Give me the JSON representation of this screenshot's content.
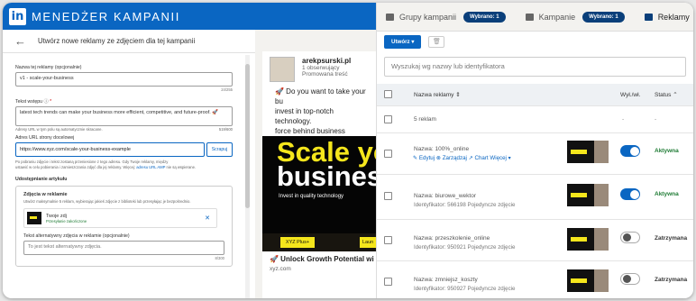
{
  "app": {
    "logo": "in",
    "title": "MENEDŻER KAMPANII"
  },
  "editor": {
    "title": "Utwórz nowe reklamy ze zdjęciem dla tej kampanii",
    "ad_name_label": "Nazwa tej reklamy (opcjonalnie)",
    "ad_name_value": "v1 - scale-your-business",
    "ad_name_count": "24/255",
    "intro_label": "Tekst wstępu",
    "intro_value": "latest tech trends can make your business more efficient, competitive, and future-proof. 🚀",
    "intro_hint": "Adresy URL w tym polu są automatycznie skracane.",
    "intro_count": "519/600",
    "url_label": "Adres URL strony docelowej",
    "url_value": "https://www.xyz.com/scale-your-business-example",
    "scrape_label": "Scrapuj",
    "url_hint_1": "Po pobraniu zdjęcie i tekst zostaną przeniesione z tego adresu. Gdy Twoje reklamy, między",
    "url_hint_2": "ustawić w celu pobierania i zamieszczania zdjęć dla jej reklamy. Więcej: ",
    "url_hint_link": "adresu URL AMP",
    "url_hint_3": " nie są wspierane.",
    "article_label": "Udostępnianie artykułu",
    "image_label": "Zdjęcia w reklamie",
    "image_hint": "Utwórz maksymalnie 5 reklam, wybierając jakieś zdjęcie z biblioteki lub przesyłając je bezpośrednio.",
    "photo_name": "Twoje zdj",
    "photo_sub": "Przesyłanie zakończone",
    "alt_label": "Tekst alternatywny zdjęcia w reklamie (opcjonalnie)",
    "alt_placeholder": "To jest tekst alternatywny zdjęcia.",
    "alt_count": "8/300"
  },
  "preview": {
    "name": "arekpsurski.pl",
    "followers": "1 obserwujący",
    "promoted": "Promowana treść",
    "body_1": "🚀 Do you want to take your bu",
    "body_2": "invest in top-notch technology.",
    "body_3": "force behind business growth. #",
    "img_big_1": "Scale yo",
    "img_big_2": "busines",
    "img_tag": "Invest in quality technology",
    "img_btn": "XYZ Plus+",
    "img_btn2": "Laun",
    "cta": "🚀 Unlock Growth Potential wi",
    "domain": "xyz.com"
  },
  "tabs": [
    {
      "label": "Grupy kampanii",
      "pill": "Wybrano: 1"
    },
    {
      "label": "Kampanie",
      "pill": "Wybrano: 1"
    },
    {
      "label": "Reklamy"
    }
  ],
  "toolbar": {
    "create": "Utwórz ▾",
    "trash": "🗑"
  },
  "search": {
    "placeholder": "Wyszukaj wg nazwy lub identyfikatora"
  },
  "table": {
    "col_name": "Nazwa reklamy",
    "col_onoff": "Wył./wł.",
    "col_status": "Status",
    "summary": "5 reklam",
    "summary_toggle": "-",
    "summary_status": "-",
    "rows": [
      {
        "name": "Nazwa: 100%_online",
        "actions": "✎ Edytuj   ⊗ Zarządzaj   ↗ Chart   Więcej ▾",
        "status": "Aktywna",
        "on": true
      },
      {
        "name": "Nazwa: biurowe_wektor",
        "id": "Identyfikator:    566198   Pojedyncze zdjęcie",
        "status": "Aktywna",
        "on": true
      },
      {
        "name": "Nazwa: przeszkolenie_online",
        "id": "Identyfikator:    950921   Pojedyncze zdjęcie",
        "status": "Zatrzymana",
        "on": false
      },
      {
        "name": "Nazwa: zmniejsz_koszty",
        "id": "Identyfikator:    950927   Pojedyncze zdjęcie",
        "status": "Zatrzymana",
        "on": false
      }
    ]
  },
  "colors": {
    "brand": "#0a66c2",
    "active": "#1e7b34",
    "paused": "#333333"
  }
}
